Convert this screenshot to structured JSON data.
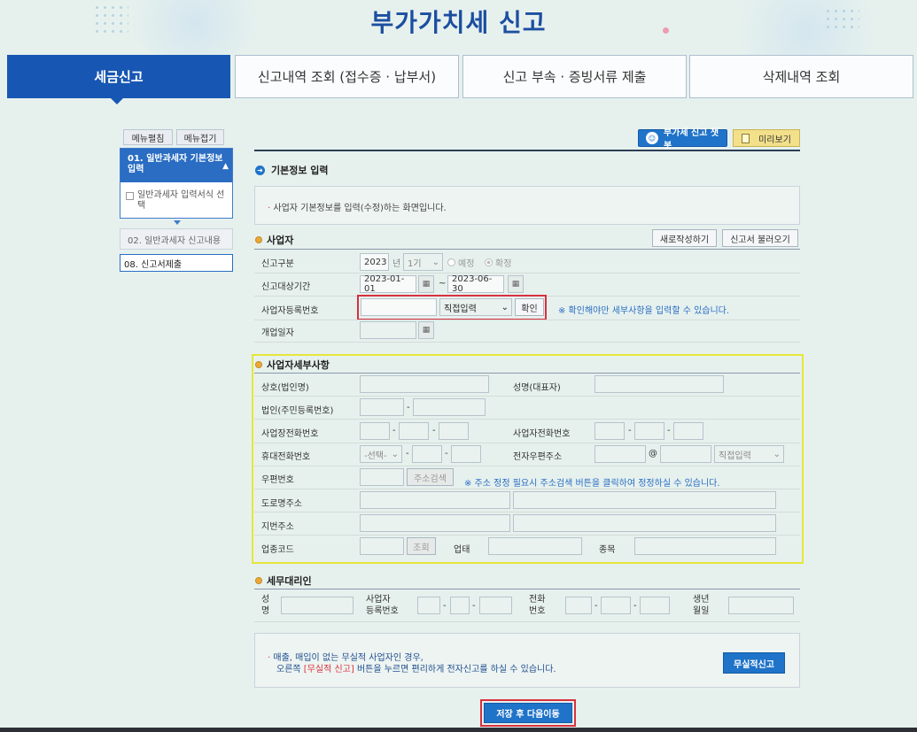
{
  "page": {
    "title": "부가가치세 신고"
  },
  "tabs": [
    {
      "label": "세금신고",
      "active": true
    },
    {
      "label": "신고내역 조회 (접수증 · 납부서)"
    },
    {
      "label": "신고 부속 · 증빙서류 제출"
    },
    {
      "label": "삭제내역 조회"
    }
  ],
  "left_menu": {
    "edit_label": "메뉴펼침",
    "collapse_label": "메뉴접기",
    "step1": "01. 일반과세자 기본정보 입력",
    "step1_sub": "일반과세자 입력서식 선택",
    "step2": "02. 일반과세자 신고내용",
    "step3": "08. 신고서제출"
  },
  "toolbar": {
    "chatbot_label": "부가세 신고 챗봇",
    "preview_label": "미리보기"
  },
  "basic": {
    "title": "기본정보 입력",
    "info": "사업자 기본정보를 입력(수정)하는 화면입니다."
  },
  "business": {
    "title": "사업자",
    "new_btn": "새로작성하기",
    "load_btn": "신고서 불러오기",
    "type_label": "신고구분",
    "year": "2023",
    "year_unit": "년",
    "period": "1기",
    "radio_planned": "예정",
    "radio_final": "확정",
    "period_label": "신고대상기간",
    "date_from": "2023-01-01",
    "tilde": "~",
    "date_to": "2023-06-30",
    "regno_label": "사업자등록번호",
    "regno_select": "직접입력",
    "confirm_btn": "확인",
    "regno_note": "※ 확인해야만 세부사항을 입력할 수 있습니다.",
    "open_label": "개업일자"
  },
  "details": {
    "title": "사업자세부사항",
    "trade_name": "상호(법인명)",
    "rep_name": "성명(대표자)",
    "corp_no": "법인(주민등록번호)",
    "biz_phone": "사업장전화번호",
    "owner_phone": "사업자전화번호",
    "mobile": "휴대전화번호",
    "mobile_select": "-선택-",
    "email": "전자우편주소",
    "at": "@",
    "email_select": "직접입력",
    "zip": "우편번호",
    "addr_search_btn": "주소검색",
    "zip_note": "※ 주소 정정 필요시 주소검색 버튼을 클릭하여 정정하실 수 있습니다.",
    "road_addr": "도로명주소",
    "lot_addr": "지번주소",
    "industry_code": "업종코드",
    "lookup_btn": "조회",
    "business_type": "업태",
    "item": "종목"
  },
  "agent": {
    "title": "세무대리인",
    "name_l1": "성",
    "name_l2": "명",
    "reg_l1": "사업자",
    "reg_l2": "등록번호",
    "phone_l1": "전화",
    "phone_l2": "번호",
    "birth_l1": "생년",
    "birth_l2": "월일"
  },
  "nil": {
    "line1": "매출, 매입이 없는 무실적 사업자인 경우,",
    "line2_a": "오른쪽 ",
    "line2_b": "[무실적 신고]",
    "line2_c": " 버튼을 누르면 편리하게 전자신고를 하실 수 있습니다.",
    "btn": "무실적신고"
  },
  "submit": {
    "label": "저장 후 다음이동"
  },
  "colors": {
    "primary": "#1757b3",
    "highlight_red": "#d9303e",
    "highlight_yellow": "#e6e63a"
  }
}
